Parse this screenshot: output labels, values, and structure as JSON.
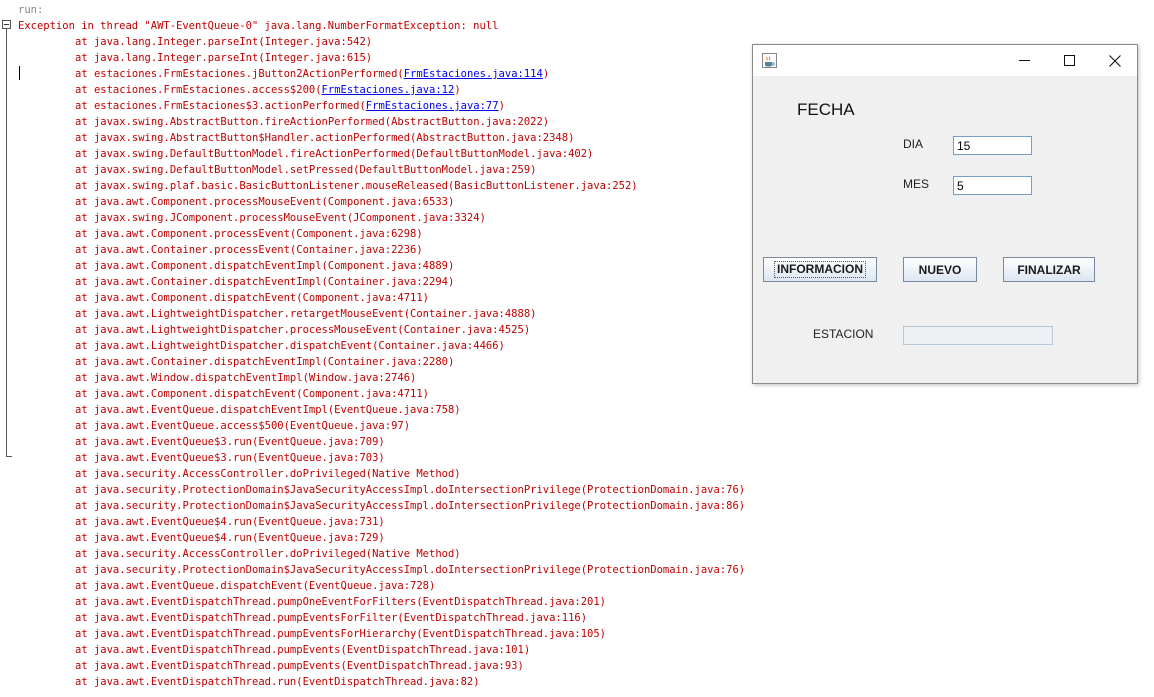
{
  "console": {
    "run_label": "run:",
    "exception": "Exception in thread \"AWT-EventQueue-0\" java.lang.NumberFormatException: null",
    "frames": [
      {
        "text": "at java.lang.Integer.parseInt(Integer.java:542)"
      },
      {
        "text": "at java.lang.Integer.parseInt(Integer.java:615)"
      },
      {
        "pre": "at estaciones.FrmEstaciones.jButton2ActionPerformed(",
        "link": "FrmEstaciones.java:114",
        "post": ")"
      },
      {
        "pre": "at estaciones.FrmEstaciones.access$200(",
        "link": "FrmEstaciones.java:12",
        "post": ")"
      },
      {
        "pre": "at estaciones.FrmEstaciones$3.actionPerformed(",
        "link": "FrmEstaciones.java:77",
        "post": ")"
      },
      {
        "text": "at javax.swing.AbstractButton.fireActionPerformed(AbstractButton.java:2022)"
      },
      {
        "text": "at javax.swing.AbstractButton$Handler.actionPerformed(AbstractButton.java:2348)"
      },
      {
        "text": "at javax.swing.DefaultButtonModel.fireActionPerformed(DefaultButtonModel.java:402)"
      },
      {
        "text": "at javax.swing.DefaultButtonModel.setPressed(DefaultButtonModel.java:259)"
      },
      {
        "text": "at javax.swing.plaf.basic.BasicButtonListener.mouseReleased(BasicButtonListener.java:252)"
      },
      {
        "text": "at java.awt.Component.processMouseEvent(Component.java:6533)"
      },
      {
        "text": "at javax.swing.JComponent.processMouseEvent(JComponent.java:3324)"
      },
      {
        "text": "at java.awt.Component.processEvent(Component.java:6298)"
      },
      {
        "text": "at java.awt.Container.processEvent(Container.java:2236)"
      },
      {
        "text": "at java.awt.Component.dispatchEventImpl(Component.java:4889)"
      },
      {
        "text": "at java.awt.Container.dispatchEventImpl(Container.java:2294)"
      },
      {
        "text": "at java.awt.Component.dispatchEvent(Component.java:4711)"
      },
      {
        "text": "at java.awt.LightweightDispatcher.retargetMouseEvent(Container.java:4888)"
      },
      {
        "text": "at java.awt.LightweightDispatcher.processMouseEvent(Container.java:4525)"
      },
      {
        "text": "at java.awt.LightweightDispatcher.dispatchEvent(Container.java:4466)"
      },
      {
        "text": "at java.awt.Container.dispatchEventImpl(Container.java:2280)"
      },
      {
        "text": "at java.awt.Window.dispatchEventImpl(Window.java:2746)"
      },
      {
        "text": "at java.awt.Component.dispatchEvent(Component.java:4711)"
      },
      {
        "text": "at java.awt.EventQueue.dispatchEventImpl(EventQueue.java:758)"
      },
      {
        "text": "at java.awt.EventQueue.access$500(EventQueue.java:97)"
      },
      {
        "text": "at java.awt.EventQueue$3.run(EventQueue.java:709)"
      },
      {
        "text": "at java.awt.EventQueue$3.run(EventQueue.java:703)"
      },
      {
        "text": "at java.security.AccessController.doPrivileged(Native Method)"
      },
      {
        "text": "at java.security.ProtectionDomain$JavaSecurityAccessImpl.doIntersectionPrivilege(ProtectionDomain.java:76)"
      },
      {
        "text": "at java.security.ProtectionDomain$JavaSecurityAccessImpl.doIntersectionPrivilege(ProtectionDomain.java:86)"
      },
      {
        "text": "at java.awt.EventQueue$4.run(EventQueue.java:731)"
      },
      {
        "text": "at java.awt.EventQueue$4.run(EventQueue.java:729)"
      },
      {
        "text": "at java.security.AccessController.doPrivileged(Native Method)"
      },
      {
        "text": "at java.security.ProtectionDomain$JavaSecurityAccessImpl.doIntersectionPrivilege(ProtectionDomain.java:76)"
      },
      {
        "text": "at java.awt.EventQueue.dispatchEvent(EventQueue.java:728)"
      },
      {
        "text": "at java.awt.EventDispatchThread.pumpOneEventForFilters(EventDispatchThread.java:201)"
      },
      {
        "text": "at java.awt.EventDispatchThread.pumpEventsForFilter(EventDispatchThread.java:116)"
      },
      {
        "text": "at java.awt.EventDispatchThread.pumpEventsForHierarchy(EventDispatchThread.java:105)"
      },
      {
        "text": "at java.awt.EventDispatchThread.pumpEvents(EventDispatchThread.java:101)"
      },
      {
        "text": "at java.awt.EventDispatchThread.pumpEvents(EventDispatchThread.java:93)"
      },
      {
        "text": "at java.awt.EventDispatchThread.run(EventDispatchThread.java:82)"
      }
    ],
    "colors": {
      "error_text": "#c00000",
      "run_text": "#888888",
      "link": "#0000ee"
    }
  },
  "window": {
    "titlebar": {
      "app_icon": "java-coffee-cup-icon",
      "minimize_icon": "minimize-icon",
      "maximize_icon": "maximize-icon",
      "close_icon": "close-icon"
    },
    "heading": "FECHA",
    "dia_label": "DIA",
    "dia_value": "15",
    "mes_label": "MES",
    "mes_value": "5",
    "buttons": {
      "informacion": "INFORMACION",
      "nuevo": "NUEVO",
      "finalizar": "FINALIZAR"
    },
    "estacion_label": "ESTACION",
    "estacion_value": ""
  }
}
